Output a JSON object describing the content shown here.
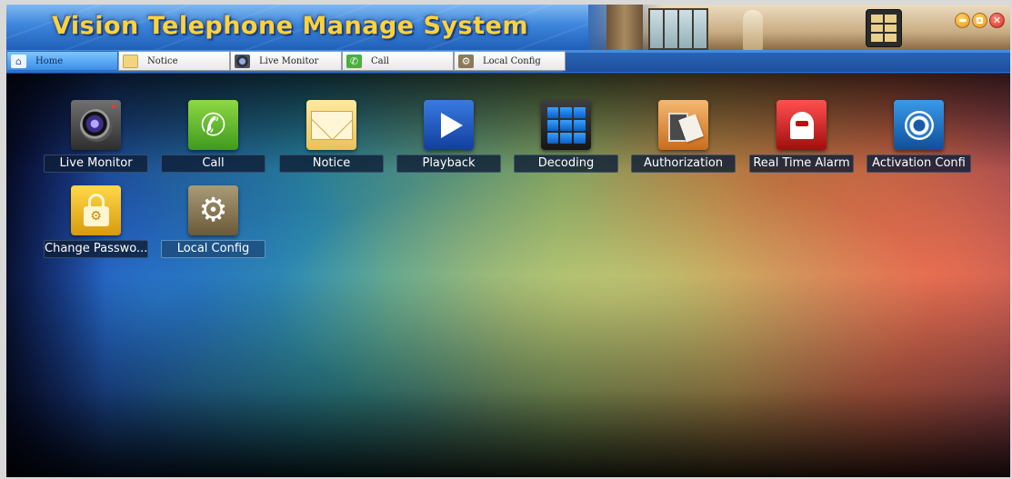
{
  "window": {
    "title": "Vision Telephone Manage System",
    "controls": {
      "minimize_icon": "minimize-icon",
      "maximize_icon": "maximize-icon",
      "close_icon": "close-icon"
    },
    "device_icon": "intercom-panel-icon"
  },
  "tabs": [
    {
      "label": "Home",
      "icon": "home-icon",
      "active": true
    },
    {
      "label": "Notice",
      "icon": "envelope-icon",
      "active": false
    },
    {
      "label": "Live Monitor",
      "icon": "camera-icon",
      "active": false
    },
    {
      "label": "Call",
      "icon": "phone-icon",
      "active": false
    },
    {
      "label": "Local Config",
      "icon": "gear-icon",
      "active": false
    }
  ],
  "tiles": [
    {
      "label": "Live Monitor",
      "icon": "camera-icon"
    },
    {
      "label": "Call",
      "icon": "phone-icon"
    },
    {
      "label": "Notice",
      "icon": "envelope-icon"
    },
    {
      "label": "Playback",
      "icon": "play-icon"
    },
    {
      "label": "Decoding",
      "icon": "grid-icon"
    },
    {
      "label": "Authorization",
      "icon": "card-icon"
    },
    {
      "label": "Real Time Alarm",
      "icon": "alarm-icon"
    },
    {
      "label": "Activation Confi",
      "icon": "activation-icon"
    },
    {
      "label": "Change Passwo...",
      "icon": "lock-icon"
    },
    {
      "label": "Local Config",
      "icon": "gear-icon",
      "selected": true
    }
  ],
  "colors": {
    "title_text": "#ffd23a",
    "titlebar_blue": "#3d86dc",
    "active_tab": "#3a8fe6",
    "tile_label_bg": "#0f1e37"
  }
}
